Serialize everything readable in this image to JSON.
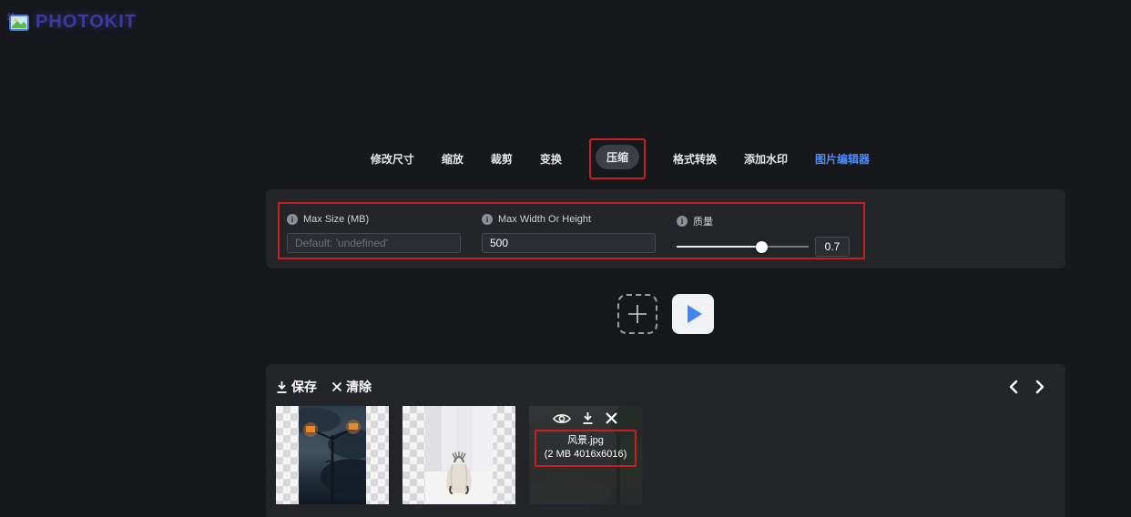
{
  "header": {
    "logo_text": "PHOTOKIT"
  },
  "tabs": {
    "active_label": "压缩",
    "items": [
      {
        "label": "修改尺寸"
      },
      {
        "label": "缩放"
      },
      {
        "label": "裁剪"
      },
      {
        "label": "变换"
      },
      {
        "label": "压缩"
      },
      {
        "label": "格式转换"
      },
      {
        "label": "添加水印"
      },
      {
        "label": "图片编辑器"
      }
    ]
  },
  "compress_form": {
    "max_size": {
      "label": "Max Size (MB)",
      "value": "",
      "placeholder": "Default: 'undefined'"
    },
    "max_width_or_height": {
      "label": "Max Width Or Height",
      "value": "500"
    },
    "quality": {
      "label": "质量",
      "value": "0.7",
      "slider_position_percent": 65
    }
  },
  "gallery_toolbar": {
    "save_label": "保存",
    "clear_label": "清除"
  },
  "gallery": {
    "items": [
      {
        "kind": "thumbnail",
        "description": "night street-lamp photo with transparent side strips"
      },
      {
        "kind": "thumbnail",
        "description": "white bag photo with transparent side strips"
      },
      {
        "kind": "thumbnail-selected",
        "filename": "风景.jpg",
        "fileinfo": "(2 MB 4016x6016)"
      }
    ]
  },
  "icons": {
    "logo": "photo-image-icon",
    "info": "circled-i",
    "add_image": "plus",
    "run": "play-triangle",
    "save": "download-arrow",
    "clear": "x-cross",
    "prev": "chevron-left",
    "next": "chevron-right",
    "preview": "eye",
    "download": "download-arrow",
    "close": "x-cross"
  },
  "colors": {
    "page_bg": "#17181c",
    "panel_bg": "#232529",
    "highlight_red": "#c8201c",
    "link_blue": "#4e8df6",
    "play_blue": "#4285f4",
    "logo_purple": "#3e3a9c"
  }
}
